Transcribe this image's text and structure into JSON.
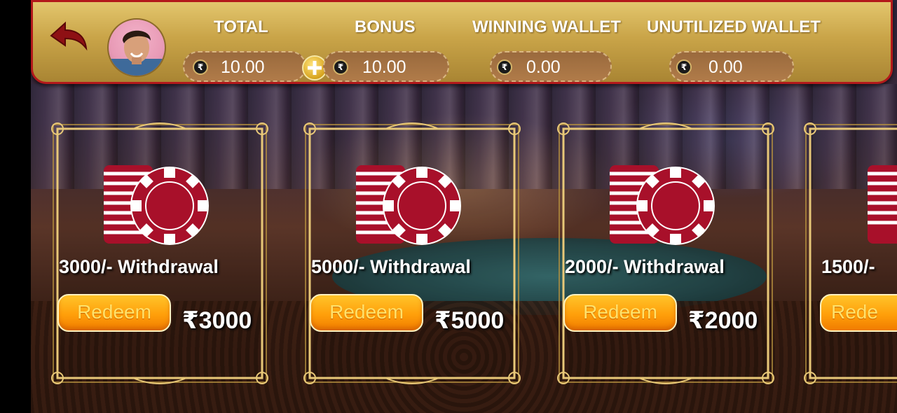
{
  "header": {
    "wallets": [
      {
        "title": "TOTAL",
        "amount": "10.00",
        "currency_symbol": "₹"
      },
      {
        "title": "BONUS",
        "amount": "10.00",
        "currency_symbol": "₹"
      },
      {
        "title": "WINNING WALLET",
        "amount": "0.00",
        "currency_symbol": "₹"
      },
      {
        "title": "UNUTILIZED WALLET",
        "amount": "0.00",
        "currency_symbol": "₹"
      }
    ],
    "icons": {
      "back": "back-arrow-icon",
      "avatar": "user-avatar",
      "add": "plus-icon"
    }
  },
  "offers": [
    {
      "title": "3000/- Withdrawal",
      "button": "Redeem",
      "price": "₹3000"
    },
    {
      "title": "5000/- Withdrawal",
      "button": "Redeem",
      "price": "₹5000"
    },
    {
      "title": "2000/- Withdrawal",
      "button": "Redeem",
      "price": "₹2000"
    },
    {
      "title": "1500/-",
      "button": "Rede"
    }
  ],
  "colors": {
    "header_gold": "#c9a448",
    "header_border": "#b3191b",
    "chip_red": "#a8102a",
    "redeem_orange": "#ff9f0a",
    "frame_gold": "#e8c878"
  }
}
